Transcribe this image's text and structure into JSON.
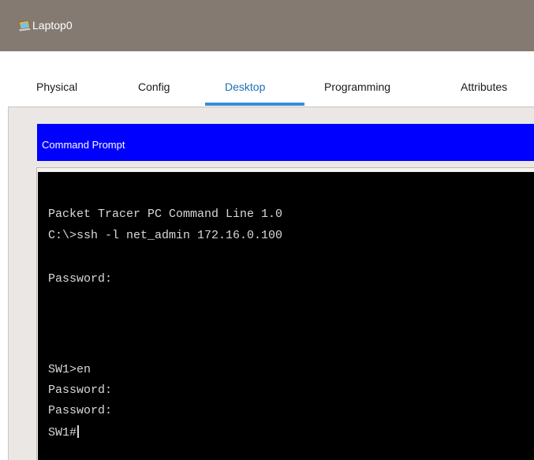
{
  "window": {
    "title": "Laptop0",
    "icon": "laptop-app-icon"
  },
  "tabs": [
    {
      "label": "Physical",
      "active": false
    },
    {
      "label": "Config",
      "active": false
    },
    {
      "label": "Desktop",
      "active": true
    },
    {
      "label": "Programming",
      "active": false
    },
    {
      "label": "Attributes",
      "active": false
    }
  ],
  "command_prompt": {
    "header": "Command Prompt",
    "lines": [
      "Packet Tracer PC Command Line 1.0",
      "C:\\>ssh -l net_admin 172.16.0.100",
      "Password:",
      "SW1>en",
      "Password:",
      "Password:",
      "SW1#"
    ]
  },
  "colors": {
    "titlebar": "#847a72",
    "header_blue": "#0000ff",
    "active_tab": "#1e6fb6",
    "terminal_bg": "#000000",
    "terminal_text": "#d8d8d8"
  }
}
